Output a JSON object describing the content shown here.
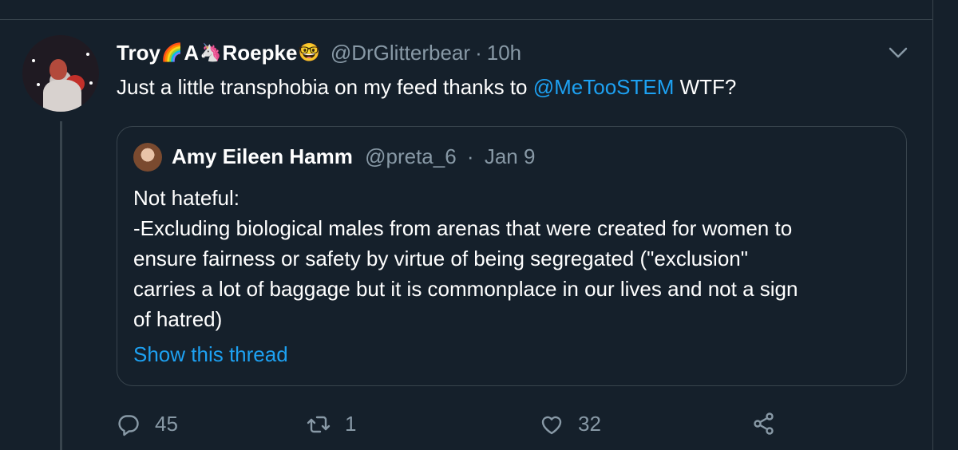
{
  "tweet": {
    "author": {
      "name_part1": "Troy",
      "name_part2": "A",
      "name_part3": "Roepke",
      "emoji1": "🌈",
      "emoji2": "🦄",
      "emoji3": "🤓",
      "handle": "@DrGlitterbear",
      "separator": "·",
      "time": "10h"
    },
    "text": {
      "before": "Just a little transphobia on my feed thanks to ",
      "mention": "@MeTooSTEM",
      "after": " WTF?"
    },
    "quoted": {
      "name": "Amy Eileen Hamm",
      "handle": "@preta_6",
      "separator": "·",
      "time": "Jan 9",
      "lines": [
        "Not hateful:",
        "-Excluding biological males from arenas that were created for women to",
        "ensure fairness or safety by virtue of being segregated (\"exclusion\"",
        "carries a lot of baggage but it is commonplace in our lives and not a sign",
        "of hatred)"
      ],
      "show_thread": "Show this thread"
    },
    "actions": {
      "reply_count": "45",
      "retweet_count": "1",
      "like_count": "32"
    },
    "icons": {
      "reply": "reply-icon",
      "retweet": "retweet-icon",
      "like": "heart-icon",
      "share": "share-icon",
      "menu": "chevron-down-icon"
    },
    "colors": {
      "background": "#15202b",
      "secondary_text": "#8899a6",
      "link": "#1da1f2",
      "border": "#38444d"
    }
  }
}
